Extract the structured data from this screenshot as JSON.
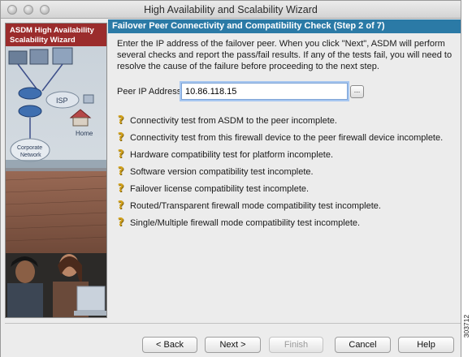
{
  "window": {
    "title": "High Availability and Scalability Wizard"
  },
  "sidebar": {
    "header_line1": "ASDM High Availability",
    "header_line2": "Scalability Wizard",
    "art_labels": {
      "isp": "ISP",
      "home": "Home",
      "corporate": "Corporate",
      "network": "Network"
    }
  },
  "step": {
    "title": "Failover Peer Connectivity and Compatibility Check (Step 2 of 7)"
  },
  "intro": "Enter the IP address of the failover peer. When you click \"Next\", ASDM will perform several checks and report the pass/fail results. If any of the tests fail, you will need to resolve the cause of the failure before proceeding to the next step.",
  "peer": {
    "label": "Peer IP Address:",
    "value": "10.86.118.15",
    "browse": "..."
  },
  "checks": [
    "Connectivity test from ASDM to the peer incomplete.",
    "Connectivity test from this firewall device to the peer firewall device incomplete.",
    "Hardware compatibility test for platform incomplete.",
    "Software version compatibility test incomplete.",
    "Failover license compatibility test incomplete.",
    "Routed/Transparent firewall mode compatibility test incomplete.",
    "Single/Multiple firewall mode compatibility test incomplete."
  ],
  "check_icon": "question-icon",
  "buttons": {
    "back": "< Back",
    "next": "Next >",
    "finish": "Finish",
    "cancel": "Cancel",
    "help": "Help"
  },
  "figure_id": "303712",
  "colors": {
    "sidebar_header": "#9b2c2c",
    "step_header": "#2b7aa6"
  }
}
